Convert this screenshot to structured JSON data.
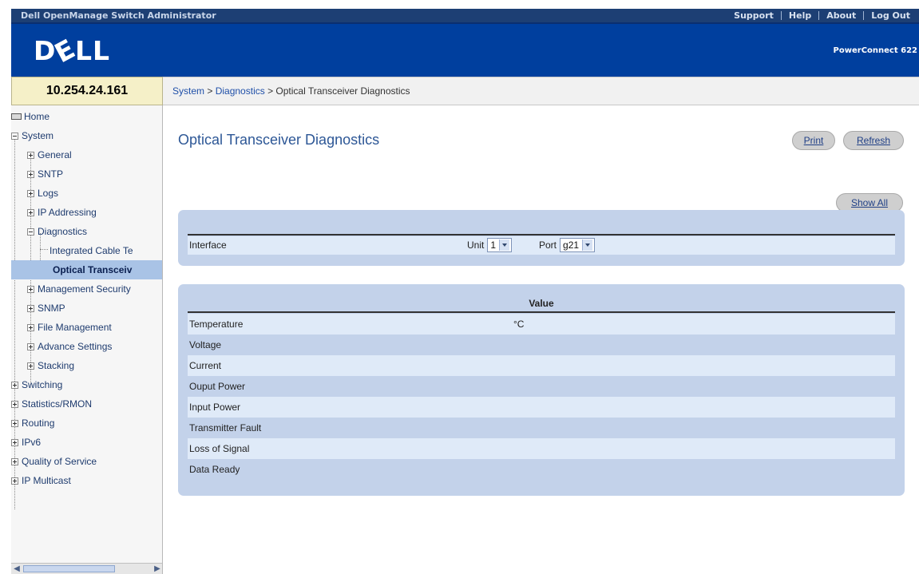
{
  "topbar": {
    "app_title": "Dell OpenManage Switch Administrator",
    "links": [
      "Support",
      "Help",
      "About",
      "Log Out"
    ]
  },
  "header": {
    "logo_text": "DELL",
    "product_name": "PowerConnect 622"
  },
  "ip_address": "10.254.24.161",
  "breadcrumb": {
    "system": "System",
    "sep": " > ",
    "diagnostics": "Diagnostics",
    "current": "Optical Transceiver Diagnostics"
  },
  "nav": {
    "items": [
      {
        "label": "Home",
        "icon": "home-icon"
      },
      {
        "label": "System",
        "icon": "minus-icon"
      },
      {
        "label": "General",
        "icon": "plus-icon"
      },
      {
        "label": "SNTP",
        "icon": "plus-icon"
      },
      {
        "label": "Logs",
        "icon": "plus-icon"
      },
      {
        "label": "IP Addressing",
        "icon": "plus-icon"
      },
      {
        "label": "Diagnostics",
        "icon": "minus-icon"
      },
      {
        "label": "Integrated Cable Te",
        "icon": "tree-branch"
      },
      {
        "label": "Optical Transceiv",
        "icon": "tree-branch",
        "selected": true
      },
      {
        "label": "Management Security",
        "icon": "plus-icon"
      },
      {
        "label": "SNMP",
        "icon": "plus-icon"
      },
      {
        "label": "File Management",
        "icon": "plus-icon"
      },
      {
        "label": "Advance Settings",
        "icon": "plus-icon"
      },
      {
        "label": "Stacking",
        "icon": "plus-icon"
      },
      {
        "label": "Switching",
        "icon": "plus-icon"
      },
      {
        "label": "Statistics/RMON",
        "icon": "plus-icon"
      },
      {
        "label": "Routing",
        "icon": "plus-icon"
      },
      {
        "label": "IPv6",
        "icon": "plus-icon"
      },
      {
        "label": "Quality of Service",
        "icon": "plus-icon"
      },
      {
        "label": "IP Multicast",
        "icon": "plus-icon"
      }
    ]
  },
  "main": {
    "title": "Optical Transceiver Diagnostics",
    "buttons": {
      "print": "Print",
      "refresh": "Refresh",
      "show_all": "Show All"
    },
    "interface": {
      "label": "Interface",
      "unit_label": "Unit",
      "unit_value": "1",
      "port_label": "Port",
      "port_value": "g21"
    },
    "values": {
      "header": "Value",
      "rows": [
        {
          "label": "Temperature",
          "value": "°C"
        },
        {
          "label": "Voltage",
          "value": ""
        },
        {
          "label": "Current",
          "value": ""
        },
        {
          "label": "Ouput Power",
          "value": ""
        },
        {
          "label": "Input Power",
          "value": ""
        },
        {
          "label": "Transmitter Fault",
          "value": ""
        },
        {
          "label": "Loss of Signal",
          "value": ""
        },
        {
          "label": "Data Ready",
          "value": ""
        }
      ]
    }
  },
  "colors": {
    "header_blue": "#003f9e",
    "topbar_navy": "#1d3f74",
    "panel_blue": "#c3d2ea",
    "row_light": "#dfeaf8",
    "link_blue": "#1f4fa8",
    "ip_box": "#f5f0c8"
  }
}
